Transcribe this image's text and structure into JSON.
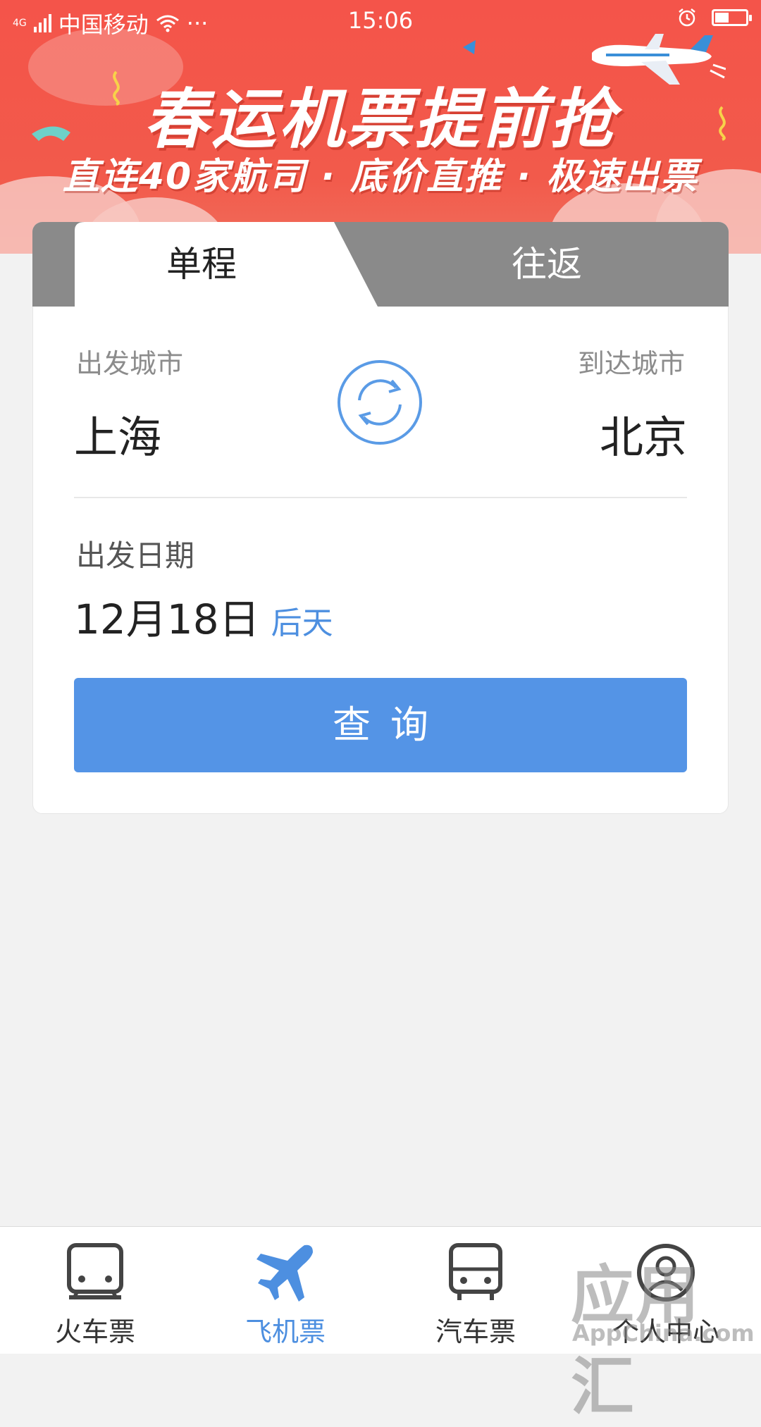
{
  "status_bar": {
    "network": "4G",
    "carrier": "中国移动",
    "more": "···",
    "time": "15:06",
    "battery_level": 0.45
  },
  "banner": {
    "title": "春运机票提前抢",
    "subtitle": "直连40家航司 · 底价直推 · 极速出票"
  },
  "trip_tabs": {
    "one_way": "单程",
    "round_trip": "往返",
    "active": "one_way"
  },
  "departure": {
    "label": "出发城市",
    "city": "上海"
  },
  "arrival": {
    "label": "到达城市",
    "city": "北京"
  },
  "date": {
    "label": "出发日期",
    "value": "12月18日",
    "relative": "后天"
  },
  "search_button": "查询",
  "bottom_nav": {
    "items": [
      {
        "label": "火车票",
        "icon": "train-icon"
      },
      {
        "label": "飞机票",
        "icon": "plane-icon"
      },
      {
        "label": "汽车票",
        "icon": "bus-icon"
      },
      {
        "label": "个人中心",
        "icon": "user-icon"
      }
    ],
    "active_index": 1
  },
  "watermark": {
    "text": "应用汇",
    "sub": "AppChina.com"
  },
  "colors": {
    "banner_red": "#f4544a",
    "accent_blue": "#5494e6",
    "tab_gray": "#8a8a8a",
    "page_bg": "#f2f2f2"
  }
}
